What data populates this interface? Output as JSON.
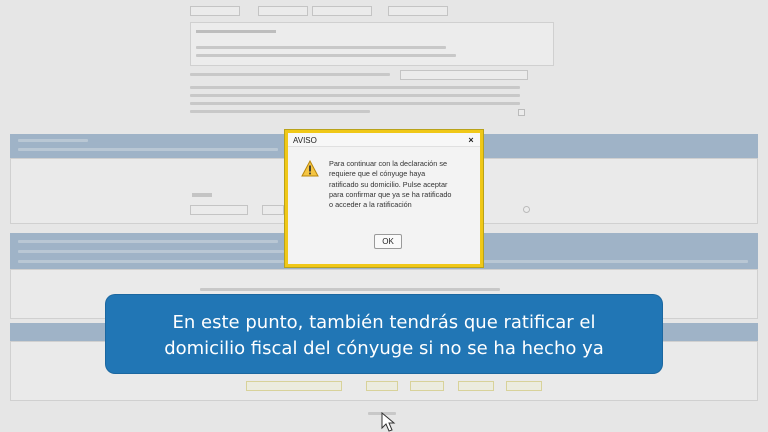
{
  "dialog": {
    "title": "AVISO",
    "close_label": "×",
    "message_lines": [
      "Para continuar con la declaración se",
      "requiere que el cónyuge haya",
      "ratificado su domicilio. Pulse aceptar",
      "para confirmar que ya se ha ratificado",
      "o acceder a la ratificación"
    ],
    "ok_label": "OK",
    "icon": "warning-icon"
  },
  "caption": {
    "line1": "En este punto, también tendrás que ratificar el",
    "line2": "domicilio fiscal del cónyuge si no se ha hecho ya"
  },
  "colors": {
    "dialog_border": "#f0c818",
    "caption_bg": "#2176b5",
    "section_header": "#9fb3c7"
  }
}
